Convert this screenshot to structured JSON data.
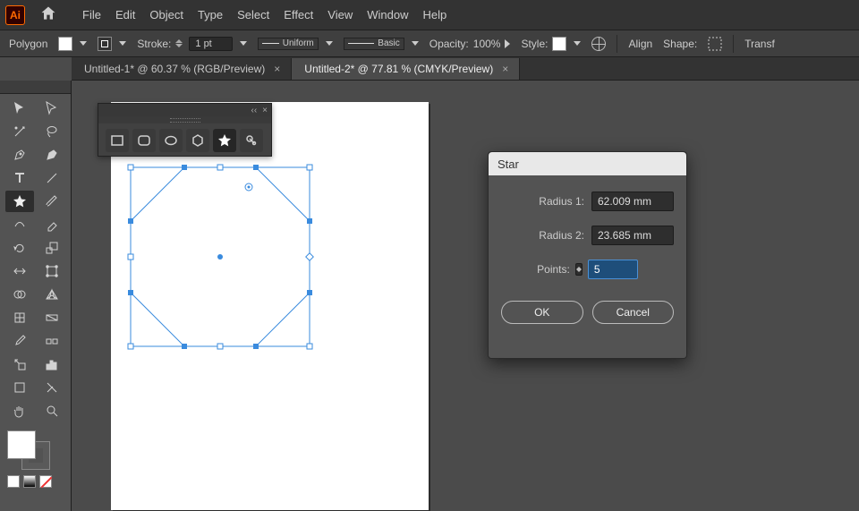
{
  "menubar": {
    "items": [
      "File",
      "Edit",
      "Object",
      "Type",
      "Select",
      "Effect",
      "View",
      "Window",
      "Help"
    ]
  },
  "optionsbar": {
    "tool_name": "Polygon",
    "stroke_label": "Stroke:",
    "stroke_value": "1 pt",
    "profile_label": "Uniform",
    "brush_label": "Basic",
    "opacity_label": "Opacity:",
    "opacity_value": "100%",
    "style_label": "Style:",
    "align_label": "Align",
    "shape_label": "Shape:",
    "transform_label": "Transf"
  },
  "tabs": [
    {
      "label": "Untitled-1* @ 60.37 % (RGB/Preview)",
      "active": false
    },
    {
      "label": "Untitled-2* @ 77.81 % (CMYK/Preview)",
      "active": true
    }
  ],
  "shape_panel": {
    "shapes": [
      "rectangle",
      "rounded-rectangle",
      "ellipse",
      "polygon",
      "star",
      "flare"
    ],
    "active": "star"
  },
  "dialog": {
    "title": "Star",
    "radius1_label": "Radius 1:",
    "radius1_value": "62.009 mm",
    "radius2_label": "Radius 2:",
    "radius2_value": "23.685 mm",
    "points_label": "Points:",
    "points_value": "5",
    "ok_label": "OK",
    "cancel_label": "Cancel"
  },
  "colors": {
    "fill": "#ffffff",
    "stroke": "#000000",
    "selection": "#3a8bde"
  },
  "toolbox": {
    "selected": "star-tool"
  }
}
